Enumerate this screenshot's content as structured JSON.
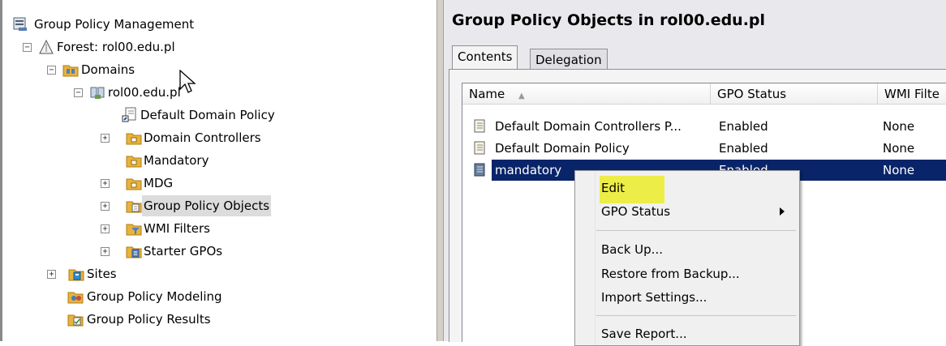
{
  "tree": {
    "root": "Group Policy Management",
    "forest": "Forest: rol00.edu.pl",
    "domains": "Domains",
    "domain": "rol00.edu.pl",
    "default_domain_policy": "Default Domain Policy",
    "domain_controllers": "Domain Controllers",
    "mandatory": "Mandatory",
    "mdg": "MDG",
    "group_policy_objects": "Group Policy Objects",
    "wmi_filters": "WMI Filters",
    "starter_gpos": "Starter GPOs",
    "sites": "Sites",
    "modeling": "Group Policy Modeling",
    "results": "Group Policy Results",
    "expander_collapsed": "+",
    "expander_expanded": "−"
  },
  "right": {
    "title": "Group Policy Objects in rol00.edu.pl",
    "tabs": [
      "Contents",
      "Delegation"
    ],
    "columns": [
      "Name",
      "GPO Status",
      "WMI Filte"
    ],
    "sort_indicator": "▲",
    "rows": [
      {
        "name": "Default Domain Controllers P...",
        "status": "Enabled",
        "wmi": "None"
      },
      {
        "name": "Default Domain Policy",
        "status": "Enabled",
        "wmi": "None"
      },
      {
        "name": "mandatory",
        "status": "Enabled",
        "wmi": "None"
      }
    ]
  },
  "context_menu": {
    "edit": "Edit",
    "gpo_status": "GPO Status",
    "back_up": "Back Up...",
    "restore": "Restore from Backup...",
    "import": "Import Settings...",
    "save_report": "Save Report..."
  },
  "colors": {
    "selection": "#0a246a",
    "highlight": "#ecec2a",
    "folder": "#e8b33a"
  }
}
